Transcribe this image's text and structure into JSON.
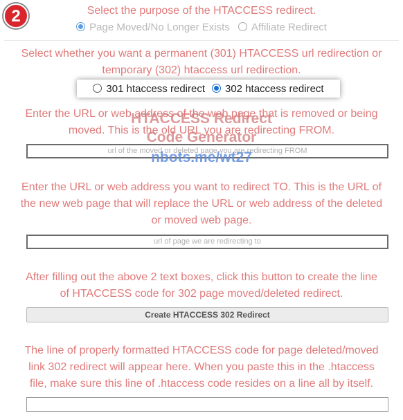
{
  "section1": {
    "step_number": "2",
    "prompt": "Select the purpose of the HTACCESS redirect.",
    "options": [
      "Page Moved/No Longer Exists",
      "Affiliate Redirect"
    ]
  },
  "section2": {
    "prompt_line1": "Select whether you want a permanent (301) HTACCESS url redirection or",
    "prompt_line2": "temporary (302) htaccess url redirection.",
    "option_301": "301 htaccess redirect",
    "option_302": "302 htaccess redirect"
  },
  "section3": {
    "prompt_line1": "Enter the URL or web address of the web page that is removed or being",
    "prompt_line2": "moved. This is the old URL you are redirecting FROM.",
    "placeholder": "url of the moved or deleted page you are redirecting FROM"
  },
  "watermark": {
    "line1": "HTACCESS Redirect",
    "line2": "Code Generator",
    "url": "nbots.me/wt27"
  },
  "section4": {
    "prompt_line1": "Enter the URL or web address you want to redirect TO. This is the URL of",
    "prompt_line2": "the new web page that will replace the URL or web address of the deleted",
    "prompt_line3": "or moved web page.",
    "placeholder": "url of page we are redirecting to"
  },
  "section5": {
    "prompt_line1": "After filling out the above 2 text boxes, click this button to create the line",
    "prompt_line2": "of HTACCESS code for 302 page moved/deleted redirect.",
    "button_label": "Create HTACCESS 302 Redirect"
  },
  "section6": {
    "prompt_line1": "The line of properly formatted HTACCESS code for page deleted/moved",
    "prompt_line2": "link 302 redirect will appear here. When you paste this in the .htaccess",
    "prompt_line3": "file, make sure this line of .htaccess code resides on a line all by itself.",
    "output_value": ""
  },
  "colors": {
    "prompt_text": "#e07a7a",
    "badge_red": "#d9262c",
    "radio_selected": "#1a6fd1"
  }
}
